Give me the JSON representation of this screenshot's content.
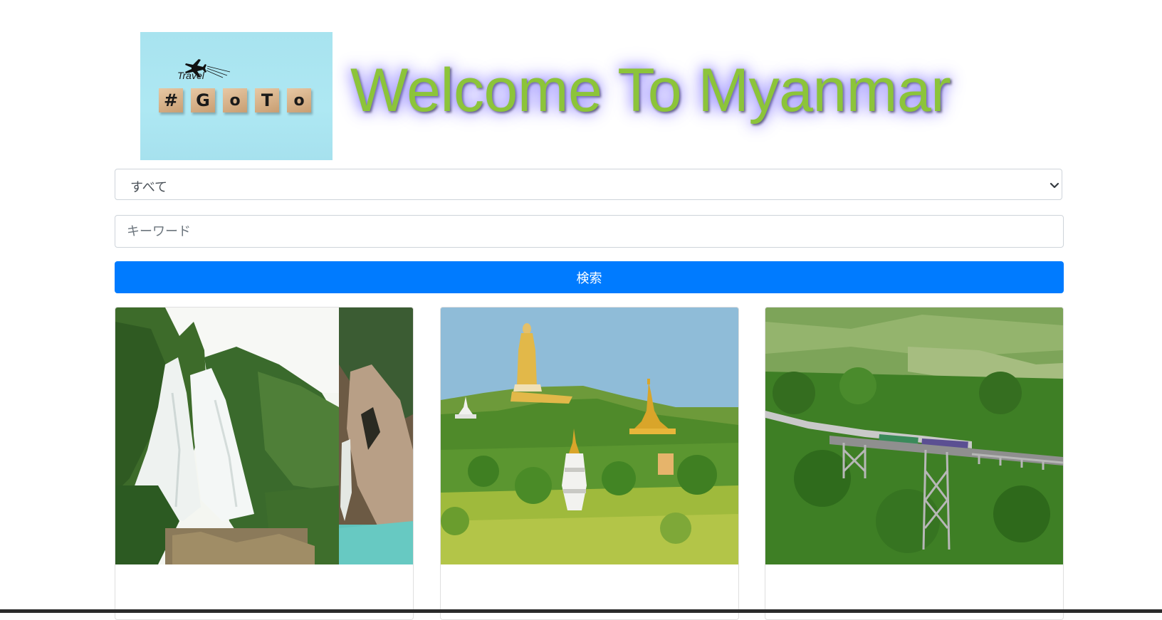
{
  "header": {
    "title": "Welcome To Myanmar",
    "logo": {
      "small_text": "Travel",
      "blocks": [
        "#",
        "G",
        "o",
        "T",
        "o"
      ]
    }
  },
  "search_form": {
    "category_select": {
      "selected": "すべて"
    },
    "keyword_input": {
      "placeholder": "キーワード",
      "value": ""
    },
    "search_button": {
      "label": "検索"
    }
  },
  "cards": [
    {
      "image": "waterfall-photo"
    },
    {
      "image": "standing-buddha-pagoda-photo"
    },
    {
      "image": "railway-viaduct-photo"
    }
  ],
  "colors": {
    "title_green": "#8cc43a",
    "title_glow": "#7b6cff",
    "primary_button": "#007bff",
    "logo_background": "#aee8f3"
  }
}
